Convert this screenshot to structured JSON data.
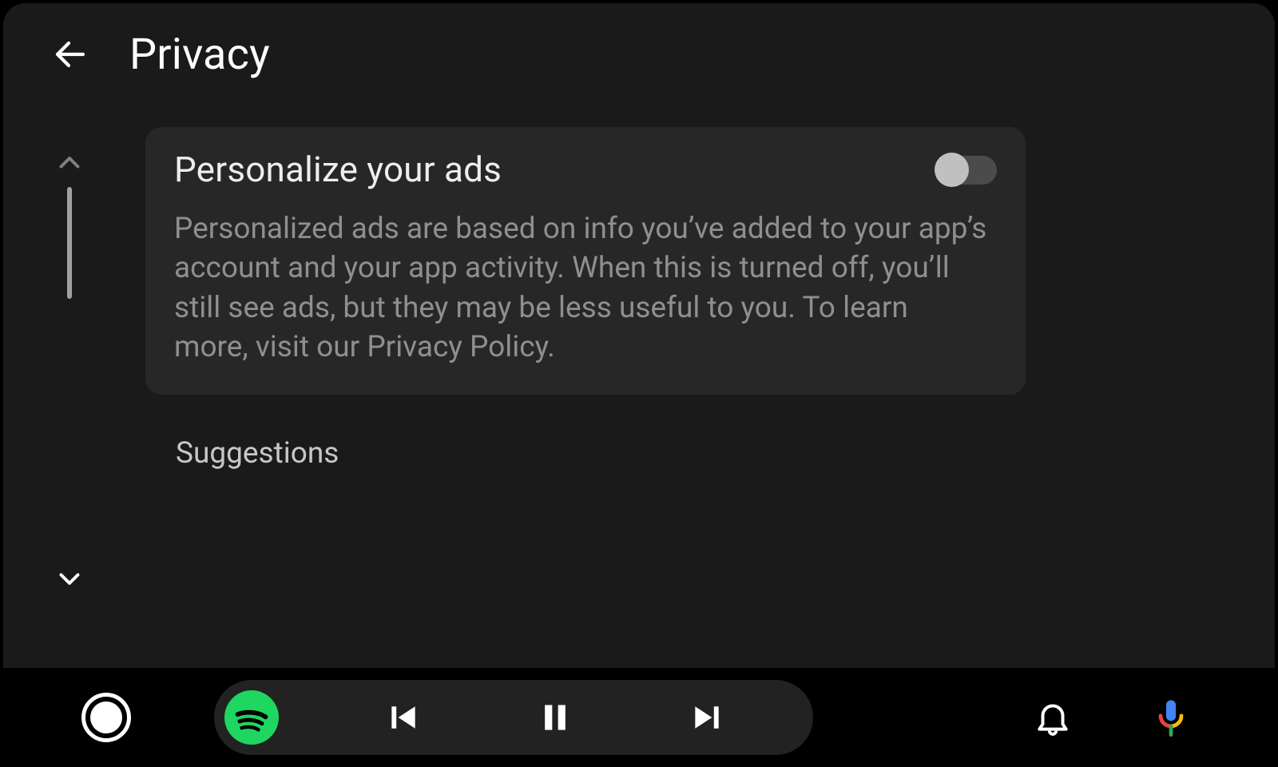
{
  "header": {
    "title": "Privacy"
  },
  "content": {
    "card": {
      "title": "Personalize your ads",
      "description": "Personalized ads are based on info you’ve added to your app’s account and your app activity. When this is turned off, you’ll still see ads, but they may be less useful to you. To learn more, visit our Privacy Policy.",
      "toggle_on": false
    },
    "section_label": "Suggestions"
  },
  "icons": {
    "back": "arrow-back",
    "scroll_up": "chevron-up",
    "scroll_down": "chevron-down",
    "home": "record-circle",
    "media_app": "spotify",
    "prev": "skip-previous",
    "playpause": "pause",
    "next": "skip-next",
    "notifications": "bell",
    "assistant": "google-mic"
  }
}
